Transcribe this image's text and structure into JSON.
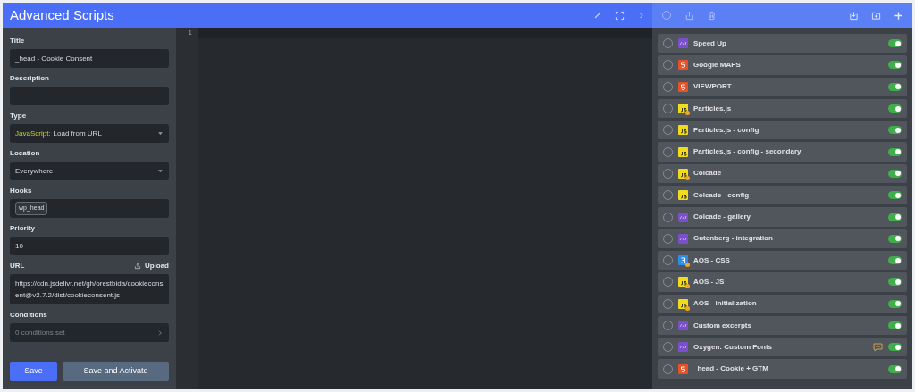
{
  "header": {
    "title": "Advanced Scripts"
  },
  "form": {
    "fields": [
      {
        "kind": "text",
        "label": "Title",
        "value": "_head - Cookie Consent"
      },
      {
        "kind": "text",
        "label": "Description"
      },
      {
        "kind": "select",
        "label": "Type",
        "prefix": "JavaScript:",
        "value": "Load from URL"
      },
      {
        "kind": "select",
        "label": "Location",
        "value": "Everywhere"
      },
      {
        "kind": "tags",
        "label": "Hooks",
        "tags": [
          "wp_head"
        ]
      },
      {
        "kind": "text",
        "label": "Priority",
        "value": "10"
      },
      {
        "kind": "textarea",
        "label": "URL",
        "action": "Upload",
        "value": "https://cdn.jsdelivr.net/gh/orestbida/cookieconsent@v2.7.2/dist/cookieconsent.js"
      },
      {
        "kind": "link",
        "label": "Conditions",
        "placeholder": "0 conditions set"
      }
    ],
    "buttons": [
      {
        "label": "Save",
        "kind": "primary"
      },
      {
        "label": "Save and Activate",
        "kind": "secondary"
      }
    ]
  },
  "editor": {
    "line_numbers": [
      "1"
    ]
  },
  "scripts": [
    {
      "name": "Speed Up",
      "kind": "php",
      "dot": false,
      "note": false,
      "checked": false,
      "on": true
    },
    {
      "name": "Google MAPS",
      "kind": "html",
      "dot": false,
      "note": false,
      "checked": false,
      "on": true
    },
    {
      "name": "VIEWPORT",
      "kind": "html",
      "dot": false,
      "note": false,
      "checked": false,
      "on": true
    },
    {
      "name": "Particles.js",
      "kind": "js",
      "dot": true,
      "note": false,
      "checked": false,
      "on": true
    },
    {
      "name": "Particles.js - config",
      "kind": "js",
      "dot": false,
      "note": false,
      "checked": false,
      "on": true
    },
    {
      "name": "Particles.js - config - secondary",
      "kind": "js",
      "dot": false,
      "note": false,
      "checked": false,
      "on": true
    },
    {
      "name": "Colcade",
      "kind": "js",
      "dot": true,
      "note": false,
      "checked": false,
      "on": true
    },
    {
      "name": "Colcade - config",
      "kind": "js",
      "dot": false,
      "note": false,
      "checked": false,
      "on": true
    },
    {
      "name": "Colcade - gallery",
      "kind": "php",
      "dot": false,
      "note": false,
      "checked": false,
      "on": true
    },
    {
      "name": "Gutenberg - integration",
      "kind": "php",
      "dot": false,
      "note": false,
      "checked": false,
      "on": true
    },
    {
      "name": "AOS - CSS",
      "kind": "css",
      "dot": true,
      "note": false,
      "checked": false,
      "on": true
    },
    {
      "name": "AOS - JS",
      "kind": "js",
      "dot": true,
      "note": false,
      "checked": false,
      "on": true
    },
    {
      "name": "AOS - initialization",
      "kind": "js",
      "dot": true,
      "note": false,
      "checked": false,
      "on": true
    },
    {
      "name": "Custom excerpts",
      "kind": "php",
      "dot": false,
      "note": false,
      "checked": false,
      "on": true
    },
    {
      "name": "Oxygen: Custom Fonts",
      "kind": "php",
      "dot": false,
      "note": true,
      "checked": false,
      "on": true
    },
    {
      "name": "_head - Cookie + GTM",
      "kind": "html",
      "dot": false,
      "note": false,
      "checked": false,
      "on": true
    }
  ]
}
